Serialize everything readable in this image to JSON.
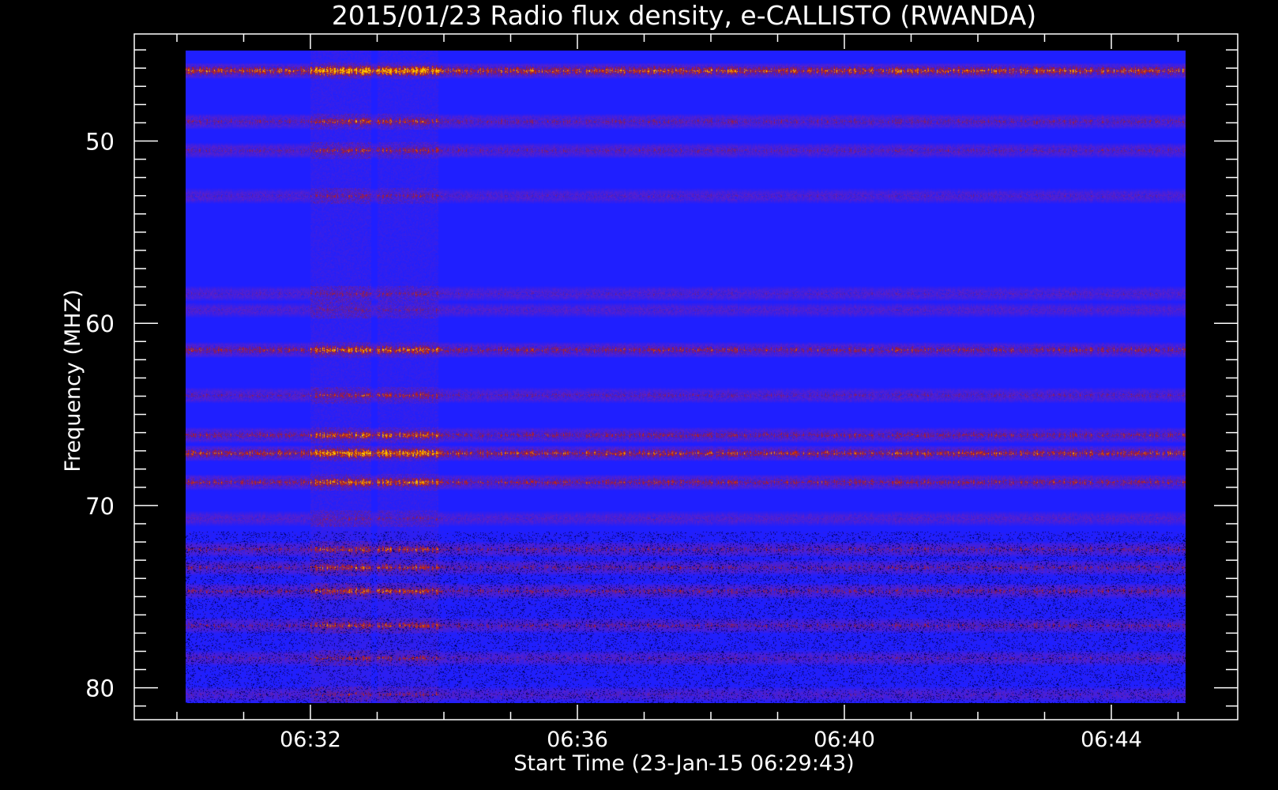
{
  "chart_data": {
    "type": "heatmap",
    "title": "2015/01/23  Radio flux density, e-CALLISTO (RWANDA)",
    "xlabel": "Start Time (23-Jan-15 06:29:43)",
    "ylabel": "Frequency (MHZ)",
    "x_ticks": [
      "06:32",
      "06:36",
      "06:40",
      "06:44"
    ],
    "y_ticks": [
      "50",
      "60",
      "70",
      "80"
    ],
    "y_axis": "inverted",
    "colors": {
      "background": "#000000",
      "low": "#1f1fff",
      "mid": "#c81e00",
      "high": "#ffd000",
      "axis": "#ffffff"
    },
    "emission_bands_mhz": [
      {
        "f": 45.6,
        "strength": 1.0
      },
      {
        "f": 48.4,
        "strength": 0.6
      },
      {
        "f": 50.0,
        "strength": 0.55
      },
      {
        "f": 52.5,
        "strength": 0.45
      },
      {
        "f": 57.9,
        "strength": 0.45
      },
      {
        "f": 58.8,
        "strength": 0.4
      },
      {
        "f": 61.0,
        "strength": 0.75
      },
      {
        "f": 63.5,
        "strength": 0.55
      },
      {
        "f": 65.7,
        "strength": 0.7
      },
      {
        "f": 66.7,
        "strength": 0.9
      },
      {
        "f": 68.3,
        "strength": 0.75
      },
      {
        "f": 70.3,
        "strength": 0.4
      },
      {
        "f": 72.0,
        "strength": 0.6
      },
      {
        "f": 73.0,
        "strength": 0.6
      },
      {
        "f": 74.3,
        "strength": 0.65
      },
      {
        "f": 76.2,
        "strength": 0.6
      },
      {
        "f": 78.0,
        "strength": 0.5
      },
      {
        "f": 80.0,
        "strength": 0.45
      }
    ],
    "burst_intervals": [
      {
        "start": "06:32",
        "end": "06:33",
        "strength": 0.9
      },
      {
        "start": "06:33",
        "end": "06:34",
        "strength": 0.8
      }
    ]
  }
}
